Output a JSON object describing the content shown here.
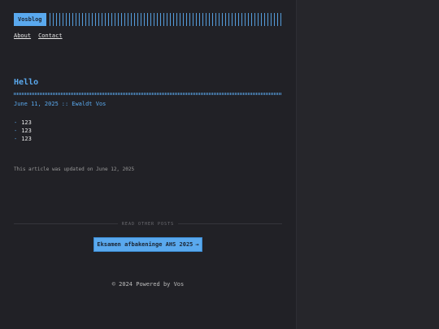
{
  "header": {
    "logo": "Vosblog"
  },
  "nav": {
    "items": [
      {
        "label": "About"
      },
      {
        "label": "Contact"
      }
    ]
  },
  "post": {
    "title": "Hello",
    "date": "June 11, 2025",
    "separator": "::",
    "author": "Ewaldt Vos",
    "list_items": [
      "123",
      "123",
      "123"
    ],
    "list_marker": "-",
    "updated": "This article was updated on June 12, 2025"
  },
  "other_posts": {
    "heading": "READ OTHER POSTS",
    "next_title": "Eksamen afbakeninge AHS 2025",
    "next_arrow": "→"
  },
  "footer": {
    "text": "© 2024 Powered by Vos"
  },
  "colors": {
    "accent": "#5aa9ee",
    "background": "#212126"
  }
}
